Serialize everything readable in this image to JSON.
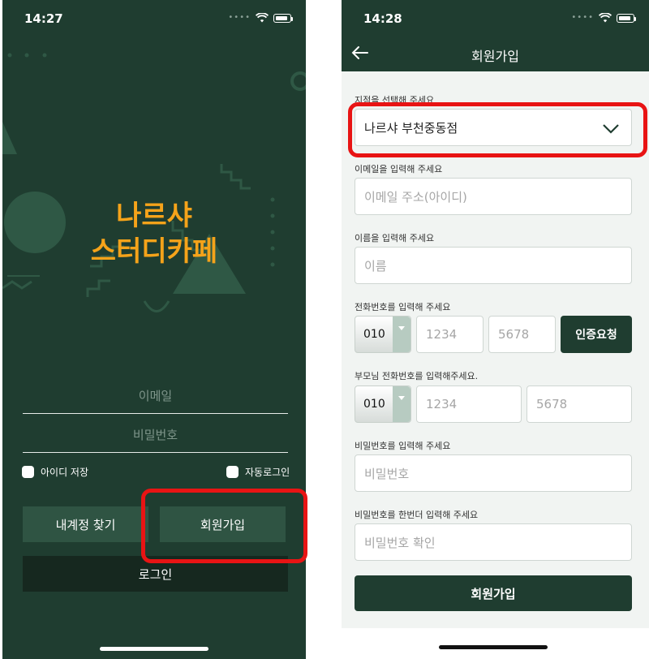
{
  "login": {
    "status_time": "14:27",
    "brand_line1": "나르샤",
    "brand_line2": "스터디카페",
    "email_placeholder": "이메일",
    "password_placeholder": "비밀번호",
    "save_id_label": "아이디 저장",
    "auto_login_label": "자동로그인",
    "find_account_label": "내계정 찾기",
    "signup_label": "회원가입",
    "login_label": "로그인"
  },
  "signup": {
    "status_time": "14:28",
    "title": "회원가입",
    "branch_label": "지점을 선택해 주세요",
    "branch_value": "나르샤 부천중동점",
    "email_label": "이메일을 입력해 주세요",
    "email_placeholder": "이메일 주소(아이디)",
    "name_label": "이름을 입력해 주세요",
    "name_placeholder": "이름",
    "phone_label": "전화번호를 입력해 주세요",
    "phone_prefix": "010",
    "phone_mid_placeholder": "1234",
    "phone_last_placeholder": "5678",
    "verify_label": "인증요청",
    "parent_phone_label": "부모님 전화번호를 입력해주세요.",
    "parent_prefix": "010",
    "parent_mid_placeholder": "1234",
    "parent_last_placeholder": "5678",
    "password_label": "비밀번호를 입력해 주세요",
    "password_placeholder": "비밀번호",
    "password_confirm_label": "비밀번호를 한번더 입력해 주세요",
    "password_confirm_placeholder": "비밀번호 확인",
    "submit_label": "회원가입"
  },
  "colors": {
    "primary_green": "#1f3d30",
    "brand_orange": "#f5a31a",
    "highlight_red": "#e81414"
  }
}
